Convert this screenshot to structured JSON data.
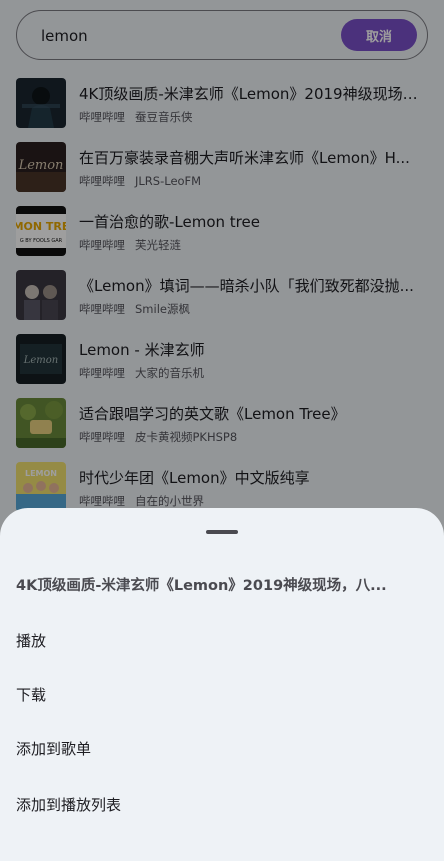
{
  "search": {
    "query": "lemon",
    "cancel_label": "取消"
  },
  "results": [
    {
      "title": "4K顶级画质-米津玄师《Lemon》2019神级现场，八...",
      "platform": "哔哩哔哩",
      "author": "蚕豆音乐侠"
    },
    {
      "title": "在百万豪装录音棚大声听米津玄师《Lemon》H...",
      "platform": "哔哩哔哩",
      "author": "JLRS-LeoFM"
    },
    {
      "title": "一首治愈的歌-Lemon tree",
      "platform": "哔哩哔哩",
      "author": "芙光轻涟"
    },
    {
      "title": "《Lemon》填词——暗杀小队「我们致死都没抛...",
      "platform": "哔哩哔哩",
      "author": "Smile源枫"
    },
    {
      "title": "Lemon - 米津玄师",
      "platform": "哔哩哔哩",
      "author": "大家的音乐机"
    },
    {
      "title": "适合跟唱学习的英文歌《Lemon Tree》",
      "platform": "哔哩哔哩",
      "author": "皮卡黄视频PKHSP8"
    },
    {
      "title": "时代少年团《Lemon》中文版纯享",
      "platform": "哔哩哔哩",
      "author": "自在的小世界"
    }
  ],
  "thumbnails": {
    "t2_text": "Lemon",
    "t3_line1": "MON TRE",
    "t3_line2": "G BY FOOLS GAR",
    "t5_text": "Lemon",
    "t7_text": "LEMON"
  },
  "sheet": {
    "title": "4K顶级画质-米津玄师《Lemon》2019神级现场，八...",
    "actions": [
      "播放",
      "下载",
      "添加到歌单",
      "添加到播放列表"
    ]
  }
}
